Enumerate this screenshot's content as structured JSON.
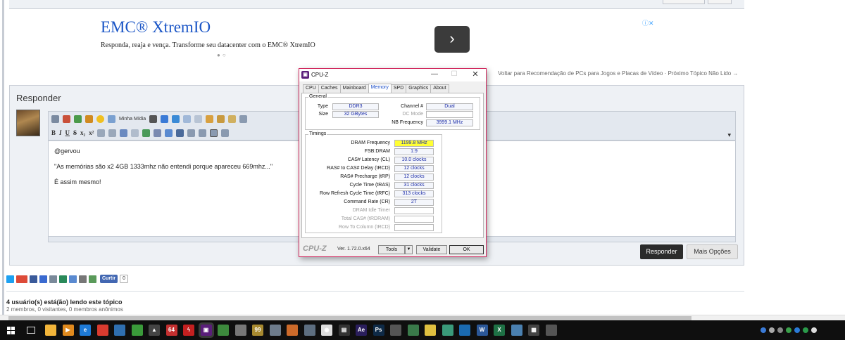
{
  "ad": {
    "title": "EMC® XtremIO",
    "description": "Responda, reaja e vença. Transforme seu datacenter com o EMC® XtremIO",
    "next_glyph": "›",
    "choices_glyph": "ⓘ✕",
    "dots": "●○"
  },
  "topic_nav": {
    "back_link": "Voltar para Recomendação de PCs para Jogos e Placas de Vídeo",
    "separator": " · ",
    "next_link": "Próximo Tópico Não Lido →"
  },
  "reply": {
    "title": "Responder",
    "toolbar_text_minha_midia": "Minha Mídia",
    "editor_lines": [
      "@gervou",
      "\"As memórias são x2 4GB 1333mhz não entendi porque apareceu 669mhz...\"",
      "É assim mesmo!"
    ],
    "reply_button": "Responder",
    "more_button": "Mais Opções"
  },
  "share": {
    "like_label": "Curtir",
    "like_count": "0"
  },
  "online_users": {
    "title": "4 usuário(s) está(ão) lendo este tópico",
    "subtitle": "2 membros, 0 visitantes, 0 membros anônimos"
  },
  "cpuz": {
    "title": "CPU-Z",
    "tabs": [
      "CPU",
      "Caches",
      "Mainboard",
      "Memory",
      "SPD",
      "Graphics",
      "About"
    ],
    "active_tab": "Memory",
    "general": {
      "group_title": "General",
      "type_label": "Type",
      "type_value": "DDR3",
      "size_label": "Size",
      "size_value": "32 GBytes",
      "channel_label": "Channel #",
      "channel_value": "Dual",
      "dc_mode_label": "DC Mode",
      "dc_mode_value": "",
      "nb_freq_label": "NB Frequency",
      "nb_freq_value": "3999.1 MHz"
    },
    "timings": {
      "group_title": "Timings",
      "rows": [
        {
          "label": "DRAM Frequency",
          "value": "1199.8 MHz"
        },
        {
          "label": "FSB:DRAM",
          "value": "1:9"
        },
        {
          "label": "CAS# Latency (CL)",
          "value": "10.0 clocks"
        },
        {
          "label": "RAS# to CAS# Delay (tRCD)",
          "value": "12 clocks"
        },
        {
          "label": "RAS# Precharge (tRP)",
          "value": "12 clocks"
        },
        {
          "label": "Cycle Time (tRAS)",
          "value": "31 clocks"
        },
        {
          "label": "Row Refresh Cycle Time (tRFC)",
          "value": "313 clocks"
        },
        {
          "label": "Command Rate (CR)",
          "value": "2T"
        },
        {
          "label": "DRAM Idle Timer",
          "value": ""
        },
        {
          "label": "Total CAS# (tRDRAM)",
          "value": ""
        },
        {
          "label": "Row To Column (tRCD)",
          "value": ""
        }
      ],
      "highlight_color": "#ffff33"
    },
    "footer": {
      "logo": "CPU-Z",
      "version": "Ver. 1.72.0.x64",
      "tools_button": "Tools",
      "validate_button": "Validate",
      "ok_button": "OK"
    },
    "border_color": "#d0275d"
  },
  "taskbar": {
    "apps": [
      {
        "name": "file-explorer",
        "color": "#f2b53a",
        "glyph": ""
      },
      {
        "name": "media-player",
        "color": "#e08a1e",
        "glyph": "▶"
      },
      {
        "name": "edge",
        "color": "#1e7ad6",
        "glyph": "e"
      },
      {
        "name": "chrome",
        "color": "#d93b2f",
        "glyph": ""
      },
      {
        "name": "app-globe",
        "color": "#2f6fb0",
        "glyph": ""
      },
      {
        "name": "app-green",
        "color": "#3a9a3a",
        "glyph": ""
      },
      {
        "name": "app-mountain",
        "color": "#444444",
        "glyph": "▲"
      },
      {
        "name": "app-64",
        "color": "#c43030",
        "glyph": "64"
      },
      {
        "name": "app-flash",
        "color": "#c42020",
        "glyph": "ϟ"
      },
      {
        "name": "cpu-z",
        "color": "#5a1e7a",
        "glyph": "▣"
      },
      {
        "name": "app-sheet",
        "color": "#3d8a3d",
        "glyph": ""
      },
      {
        "name": "app-gear",
        "color": "#777777",
        "glyph": ""
      },
      {
        "name": "app-99",
        "color": "#a88a30",
        "glyph": "99"
      },
      {
        "name": "app-folder",
        "color": "#6e7c8c",
        "glyph": ""
      },
      {
        "name": "app-paint",
        "color": "#cc6a2a",
        "glyph": ""
      },
      {
        "name": "app-tools",
        "color": "#5d6e80",
        "glyph": ""
      },
      {
        "name": "app-disc",
        "color": "#dddddd",
        "glyph": "◉"
      },
      {
        "name": "app-film",
        "color": "#333333",
        "glyph": "▤"
      },
      {
        "name": "after-effects",
        "color": "#2a1e5c",
        "glyph": "Ae"
      },
      {
        "name": "photoshop",
        "color": "#0e2a47",
        "glyph": "Ps"
      },
      {
        "name": "app-soccer",
        "color": "#555555",
        "glyph": ""
      },
      {
        "name": "app-phone",
        "color": "#3a7a4a",
        "glyph": ""
      },
      {
        "name": "app-notes",
        "color": "#e0c040",
        "glyph": ""
      },
      {
        "name": "app-leaf",
        "color": "#3a9a7a",
        "glyph": ""
      },
      {
        "name": "app-blue",
        "color": "#1a6ab0",
        "glyph": ""
      },
      {
        "name": "word",
        "color": "#2b5797",
        "glyph": "W"
      },
      {
        "name": "excel",
        "color": "#1e7145",
        "glyph": "X"
      },
      {
        "name": "app-cube",
        "color": "#4a80b0",
        "glyph": ""
      },
      {
        "name": "calculator",
        "color": "#444444",
        "glyph": "▦"
      },
      {
        "name": "app-mouse",
        "color": "#555555",
        "glyph": ""
      }
    ],
    "tray_colors": [
      "#3a7ad6",
      "#aaaaaa",
      "#888888",
      "#3aa04a",
      "#2a7ad6",
      "#2a9a4a",
      "#dddddd"
    ]
  }
}
